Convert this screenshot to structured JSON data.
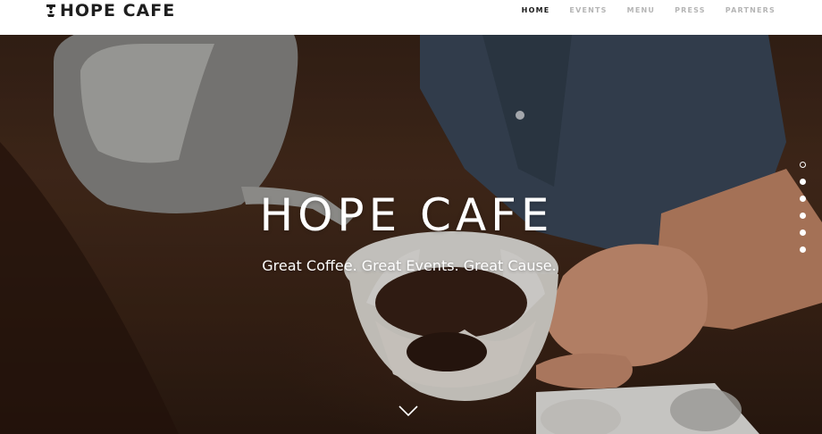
{
  "header": {
    "logo_text": "HOPE CAFE",
    "nav": [
      {
        "label": "HOME",
        "active": true
      },
      {
        "label": "EVENTS",
        "active": false
      },
      {
        "label": "MENU",
        "active": false
      },
      {
        "label": "PRESS",
        "active": false
      },
      {
        "label": "PARTNERS",
        "active": false
      }
    ]
  },
  "hero": {
    "title": "HOPE CAFE",
    "subtitle": "Great Coffee. Great Events. Great Cause.",
    "slide_count": 6,
    "active_slide": 1,
    "scroll_icon": "chevron-down-icon"
  },
  "colors": {
    "nav_active": "#1a1a1a",
    "nav_inactive": "#b5b5b5",
    "logo": "#1e1e1e",
    "hero_text": "#ffffff"
  }
}
